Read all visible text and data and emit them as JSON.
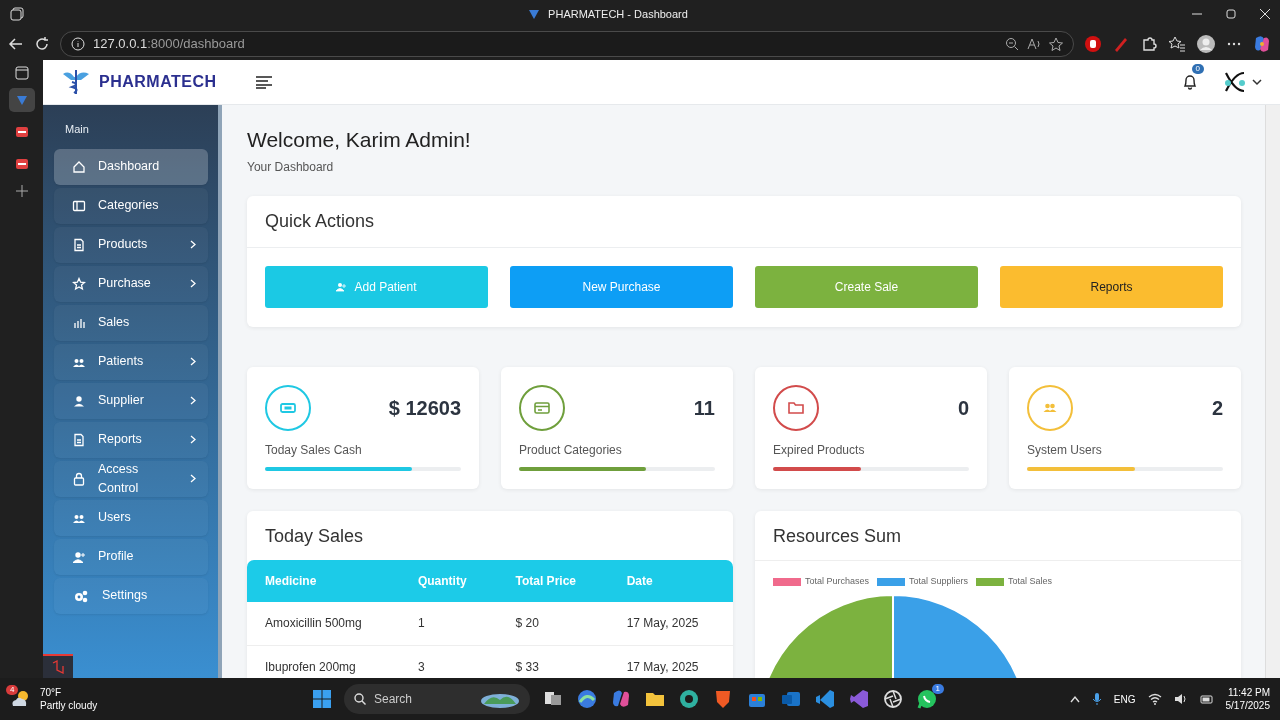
{
  "browser": {
    "tab_title": "PHARMATECH - Dashboard",
    "url_host": "127.0.0.1",
    "url_path": ":8000/dashboard"
  },
  "vertical_tabs": [
    {
      "selected": true
    },
    {
      "selected": false
    },
    {
      "selected": false
    }
  ],
  "brand": "PHARMATECH",
  "notifications": {
    "count": "0"
  },
  "sidebar": {
    "heading": "Main",
    "items": [
      {
        "label": "Dashboard",
        "selected": true,
        "has_submenu": false
      },
      {
        "label": "Categories",
        "selected": false,
        "has_submenu": false
      },
      {
        "label": "Products",
        "selected": false,
        "has_submenu": true
      },
      {
        "label": "Purchase",
        "selected": false,
        "has_submenu": true
      },
      {
        "label": "Sales",
        "selected": false,
        "has_submenu": false
      },
      {
        "label": "Patients",
        "selected": false,
        "has_submenu": true
      },
      {
        "label": "Supplier",
        "selected": false,
        "has_submenu": true
      },
      {
        "label": "Reports",
        "selected": false,
        "has_submenu": true
      },
      {
        "label": "Access Control",
        "selected": false,
        "has_submenu": true
      },
      {
        "label": "Users",
        "selected": false,
        "has_submenu": false
      },
      {
        "label": "Profile",
        "selected": false,
        "has_submenu": false
      },
      {
        "label": "Settings",
        "selected": false,
        "has_submenu": false
      }
    ]
  },
  "welcome": {
    "title": "Welcome, Karim Admin!",
    "subtitle": "Your Dashboard"
  },
  "quick_actions": {
    "title": "Quick Actions",
    "buttons": [
      {
        "label": "Add Patient",
        "color": "#1bc9e4"
      },
      {
        "label": "New Purchase",
        "color": "#0d9ef5"
      },
      {
        "label": "Create Sale",
        "color": "#7cb23f"
      },
      {
        "label": "Reports",
        "color": "#fbbc2f"
      }
    ]
  },
  "stats": [
    {
      "value": "$ 12603",
      "label": "Today Sales Cash",
      "level": 0.75,
      "color": "#1fc8e3"
    },
    {
      "value": "11",
      "label": "Product Categories",
      "level": 0.65,
      "color": "#6f9f3c"
    },
    {
      "value": "0",
      "label": "Expired Products",
      "level": 0.45,
      "color": "#d24b4b"
    },
    {
      "value": "2",
      "label": "System Users",
      "level": 0.55,
      "color": "#f3bf3a"
    }
  ],
  "today_sales": {
    "title": "Today Sales",
    "columns": [
      "Medicine",
      "Quantity",
      "Total Price",
      "Date"
    ],
    "rows": [
      [
        "Amoxicillin 500mg",
        "1",
        "$ 20",
        "17 May, 2025"
      ],
      [
        "Ibuprofen 200mg",
        "3",
        "$ 33",
        "17 May, 2025"
      ]
    ]
  },
  "resources": {
    "title": "Resources Sum",
    "legend": [
      {
        "label": "Total Purchases",
        "color": "#f06a8c"
      },
      {
        "label": "Total Suppliers",
        "color": "#3aa0e8"
      },
      {
        "label": "Total Sales",
        "color": "#7cb23f"
      }
    ]
  },
  "taskbar": {
    "weather_badge": "4",
    "temperature": "70°F",
    "condition": "Partly cloudy",
    "search_placeholder": "Search",
    "app_badge": "1",
    "language": "ENG",
    "time": "11:42 PM",
    "date": "5/17/2025"
  }
}
